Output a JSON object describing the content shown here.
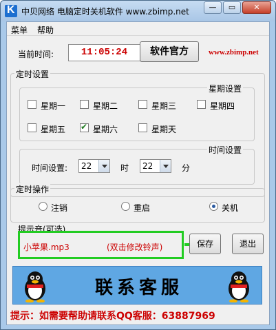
{
  "window": {
    "title": "中贝网络 电脑定时关机软件 www.zbimp.net",
    "minimize_glyph": "—",
    "maximize_glyph": "▭",
    "close_glyph": "✕"
  },
  "menu": {
    "items": [
      "菜单",
      "帮助"
    ]
  },
  "header": {
    "current_time_label": "当前时间:",
    "current_time_value": "11:05:24",
    "official_button": "软件官方",
    "site": "www.zbimp.net"
  },
  "schedule": {
    "group_title": "定时设置",
    "weekday_group_title": "星期设置",
    "weekdays": [
      {
        "label": "星期一",
        "checked": false
      },
      {
        "label": "星期二",
        "checked": false
      },
      {
        "label": "星期三",
        "checked": false
      },
      {
        "label": "星期四",
        "checked": false
      },
      {
        "label": "星期五",
        "checked": false
      },
      {
        "label": "星期六",
        "checked": true
      },
      {
        "label": "星期天",
        "checked": false
      }
    ],
    "time_group_title": "时间设置",
    "time_label": "时间设置:",
    "hour_value": "22",
    "hour_unit": "时",
    "minute_value": "22",
    "minute_unit": "分"
  },
  "operation": {
    "group_title": "定时操作",
    "options": [
      {
        "label": "注销",
        "checked": false
      },
      {
        "label": "重启",
        "checked": false
      },
      {
        "label": "关机",
        "checked": true
      }
    ]
  },
  "sound": {
    "group_title": "提示音(可选)",
    "file": "小苹果.mp3",
    "hint": "(双击修改铃声)"
  },
  "actions": {
    "save": "保存",
    "exit": "退出"
  },
  "banner": {
    "text": "联系客服"
  },
  "footer": {
    "hint": "提示：如需要帮助请联系QQ客服：63887969"
  },
  "colors": {
    "accent_red": "#cc0000",
    "highlight_green": "#22cc22",
    "banner_blue": "#5fa7e3"
  }
}
